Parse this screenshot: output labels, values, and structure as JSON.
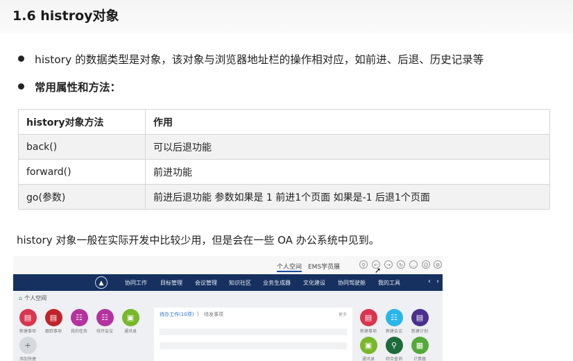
{
  "title": "1.6 histroy对象",
  "bullets": [
    "history 的数据类型是对象，该对象与浏览器地址栏的操作相对应，如前进、后退、历史记录等",
    "常用属性和方法："
  ],
  "table": {
    "headers": [
      "history对象方法",
      "作用"
    ],
    "rows": [
      [
        "back()",
        "可以后退功能"
      ],
      [
        "forward()",
        "前进功能"
      ],
      [
        "go(参数)",
        "前进后退功能 参数如果是 1 前进1个页面 如果是-1 后退1个页面"
      ]
    ]
  },
  "paragraph": "history 对象一般在实际开发中比较少用，但是会在一些 OA 办公系统中见到。",
  "oa": {
    "top_tabs": [
      "个人空间",
      "EMS学员展"
    ],
    "top_icons": [
      "search-icon",
      "back-icon",
      "forward-icon",
      "refresh-icon",
      "chat-icon",
      "user-icon",
      "settings-icon"
    ],
    "nav": [
      "协同工作",
      "目标管理",
      "会议管理",
      "知识社区",
      "业务生成器",
      "文化建设",
      "协同驾驶舱",
      "我的工具"
    ],
    "space_label": "个人空间",
    "left_apps": [
      {
        "label": "新建事项",
        "color": "#d9354f",
        "icon": "▤"
      },
      {
        "label": "跟踪事项",
        "color": "#c0242a",
        "icon": "▤"
      },
      {
        "label": "我的任务",
        "color": "#b5339e",
        "icon": "☷"
      },
      {
        "label": "待开会议",
        "color": "#b5339e",
        "icon": "☷"
      },
      {
        "label": "通讯录",
        "color": "#78b82a",
        "icon": "▣"
      }
    ],
    "add_label": "添加快捷",
    "panel_tabs": [
      "待办工作(10项)",
      "待发事项"
    ],
    "panel_more": "更多",
    "right_apps": [
      {
        "label": "新建事项",
        "color": "#d9354f",
        "icon": "▤"
      },
      {
        "label": "新建会议",
        "color": "#29b6e8",
        "icon": "☷"
      },
      {
        "label": "新建计划",
        "color": "#4a2f8f",
        "icon": "▤"
      },
      {
        "label": "通讯录",
        "color": "#78b82a",
        "icon": "▣"
      },
      {
        "label": "综合查询",
        "color": "#1e6b3a",
        "icon": "⚲"
      },
      {
        "label": "计算器",
        "color": "#55a83a",
        "icon": "▦"
      }
    ]
  }
}
